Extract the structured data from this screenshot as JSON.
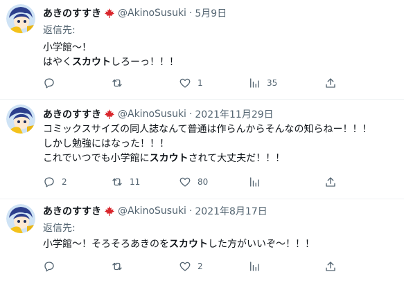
{
  "tweets": [
    {
      "name": "あきのすすき",
      "handle": "@AkinoSusuki",
      "separator": "·",
      "date": "5月9日",
      "reply_label": "返信先:",
      "lines": [
        [
          "小学館〜！"
        ],
        [
          "はやく",
          "スカウト",
          "しろーっ！！！"
        ]
      ],
      "counts": {
        "reply": "",
        "retweet": "",
        "like": "1",
        "views": "35"
      }
    },
    {
      "name": "あきのすすき",
      "handle": "@AkinoSusuki",
      "separator": "·",
      "date": "2021年11月29日",
      "lines": [
        [
          "コミックスサイズの同人誌なんて普通は作らんからそんなの知らねー！！！"
        ],
        [
          "しかし勉強にはなった！！！"
        ],
        [
          "これでいつでも小学館に",
          "スカウト",
          "されて大丈夫だ！！！"
        ]
      ],
      "counts": {
        "reply": "2",
        "retweet": "11",
        "like": "80",
        "views": ""
      }
    },
    {
      "name": "あきのすすき",
      "handle": "@AkinoSusuki",
      "separator": "·",
      "date": "2021年8月17日",
      "reply_label": "返信先:",
      "lines": [
        [
          "小学館〜！そろそろあきのを",
          "スカウト",
          "した方がいいぞ〜！！！"
        ]
      ],
      "counts": {
        "reply": "",
        "retweet": "",
        "like": "2",
        "views": ""
      }
    }
  ],
  "icons": {
    "flag": "maple-leaf-icon",
    "reply": "reply-icon",
    "retweet": "retweet-icon",
    "like": "heart-icon",
    "views": "views-icon",
    "share": "share-icon"
  },
  "colors": {
    "text": "#0f1419",
    "secondary": "#536471",
    "divider": "#eff3f4",
    "leaf": "#d9262c"
  }
}
